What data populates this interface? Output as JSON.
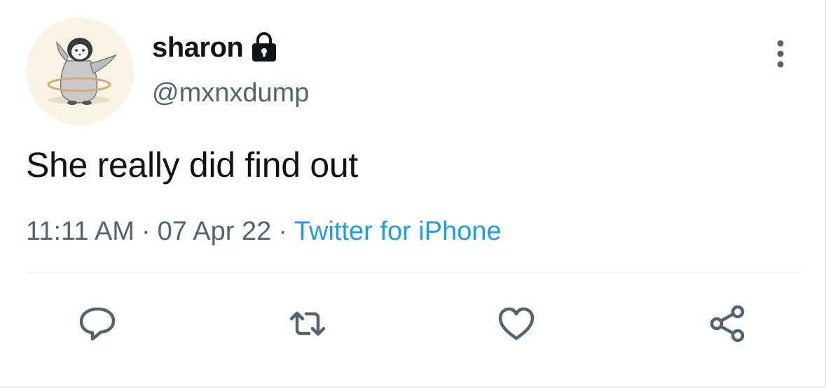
{
  "tweet": {
    "author": {
      "display_name": "sharon",
      "handle": "@mxnxdump",
      "protected_icon": "lock-icon",
      "avatar_icon": "penguin-hula-hoop-avatar"
    },
    "text": "She really did find out",
    "meta": {
      "time": "11:11 AM",
      "separator": "·",
      "date": "07 Apr 22",
      "source": "Twitter for iPhone"
    },
    "actions": [
      {
        "name": "reply",
        "icon": "reply-icon"
      },
      {
        "name": "retweet",
        "icon": "retweet-icon"
      },
      {
        "name": "like",
        "icon": "heart-icon"
      },
      {
        "name": "share",
        "icon": "share-icon"
      }
    ],
    "more_icon": "more-vertical-icon"
  },
  "colors": {
    "text_primary": "#0f1419",
    "text_secondary": "#536471",
    "link": "#1d9bf0",
    "icon": "#536471",
    "divider": "#eff3f4"
  }
}
